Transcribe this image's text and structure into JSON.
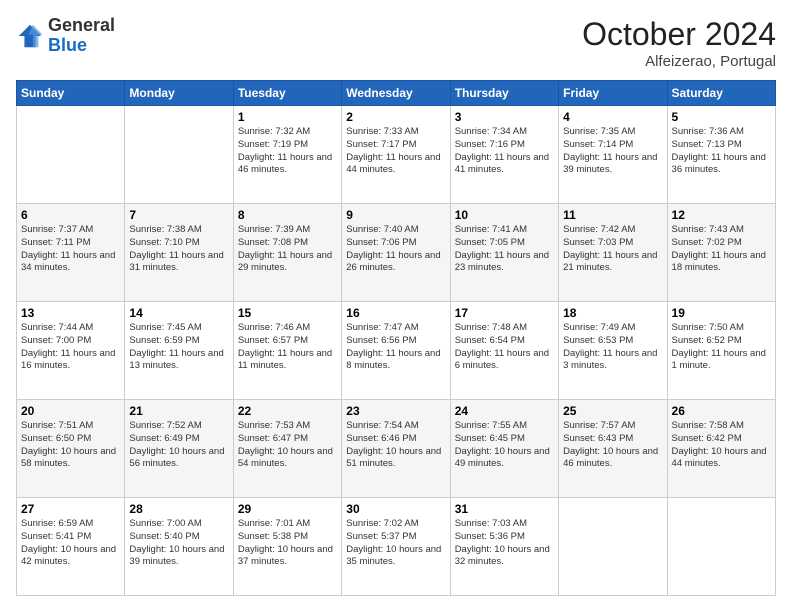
{
  "logo": {
    "general": "General",
    "blue": "Blue"
  },
  "header": {
    "month": "October 2024",
    "location": "Alfeizerao, Portugal"
  },
  "weekdays": [
    "Sunday",
    "Monday",
    "Tuesday",
    "Wednesday",
    "Thursday",
    "Friday",
    "Saturday"
  ],
  "weeks": [
    [
      null,
      null,
      {
        "day": 1,
        "sunrise": "7:32 AM",
        "sunset": "7:19 PM",
        "daylight": "11 hours and 46 minutes."
      },
      {
        "day": 2,
        "sunrise": "7:33 AM",
        "sunset": "7:17 PM",
        "daylight": "11 hours and 44 minutes."
      },
      {
        "day": 3,
        "sunrise": "7:34 AM",
        "sunset": "7:16 PM",
        "daylight": "11 hours and 41 minutes."
      },
      {
        "day": 4,
        "sunrise": "7:35 AM",
        "sunset": "7:14 PM",
        "daylight": "11 hours and 39 minutes."
      },
      {
        "day": 5,
        "sunrise": "7:36 AM",
        "sunset": "7:13 PM",
        "daylight": "11 hours and 36 minutes."
      }
    ],
    [
      {
        "day": 6,
        "sunrise": "7:37 AM",
        "sunset": "7:11 PM",
        "daylight": "11 hours and 34 minutes."
      },
      {
        "day": 7,
        "sunrise": "7:38 AM",
        "sunset": "7:10 PM",
        "daylight": "11 hours and 31 minutes."
      },
      {
        "day": 8,
        "sunrise": "7:39 AM",
        "sunset": "7:08 PM",
        "daylight": "11 hours and 29 minutes."
      },
      {
        "day": 9,
        "sunrise": "7:40 AM",
        "sunset": "7:06 PM",
        "daylight": "11 hours and 26 minutes."
      },
      {
        "day": 10,
        "sunrise": "7:41 AM",
        "sunset": "7:05 PM",
        "daylight": "11 hours and 23 minutes."
      },
      {
        "day": 11,
        "sunrise": "7:42 AM",
        "sunset": "7:03 PM",
        "daylight": "11 hours and 21 minutes."
      },
      {
        "day": 12,
        "sunrise": "7:43 AM",
        "sunset": "7:02 PM",
        "daylight": "11 hours and 18 minutes."
      }
    ],
    [
      {
        "day": 13,
        "sunrise": "7:44 AM",
        "sunset": "7:00 PM",
        "daylight": "11 hours and 16 minutes."
      },
      {
        "day": 14,
        "sunrise": "7:45 AM",
        "sunset": "6:59 PM",
        "daylight": "11 hours and 13 minutes."
      },
      {
        "day": 15,
        "sunrise": "7:46 AM",
        "sunset": "6:57 PM",
        "daylight": "11 hours and 11 minutes."
      },
      {
        "day": 16,
        "sunrise": "7:47 AM",
        "sunset": "6:56 PM",
        "daylight": "11 hours and 8 minutes."
      },
      {
        "day": 17,
        "sunrise": "7:48 AM",
        "sunset": "6:54 PM",
        "daylight": "11 hours and 6 minutes."
      },
      {
        "day": 18,
        "sunrise": "7:49 AM",
        "sunset": "6:53 PM",
        "daylight": "11 hours and 3 minutes."
      },
      {
        "day": 19,
        "sunrise": "7:50 AM",
        "sunset": "6:52 PM",
        "daylight": "11 hours and 1 minute."
      }
    ],
    [
      {
        "day": 20,
        "sunrise": "7:51 AM",
        "sunset": "6:50 PM",
        "daylight": "10 hours and 58 minutes."
      },
      {
        "day": 21,
        "sunrise": "7:52 AM",
        "sunset": "6:49 PM",
        "daylight": "10 hours and 56 minutes."
      },
      {
        "day": 22,
        "sunrise": "7:53 AM",
        "sunset": "6:47 PM",
        "daylight": "10 hours and 54 minutes."
      },
      {
        "day": 23,
        "sunrise": "7:54 AM",
        "sunset": "6:46 PM",
        "daylight": "10 hours and 51 minutes."
      },
      {
        "day": 24,
        "sunrise": "7:55 AM",
        "sunset": "6:45 PM",
        "daylight": "10 hours and 49 minutes."
      },
      {
        "day": 25,
        "sunrise": "7:57 AM",
        "sunset": "6:43 PM",
        "daylight": "10 hours and 46 minutes."
      },
      {
        "day": 26,
        "sunrise": "7:58 AM",
        "sunset": "6:42 PM",
        "daylight": "10 hours and 44 minutes."
      }
    ],
    [
      {
        "day": 27,
        "sunrise": "6:59 AM",
        "sunset": "5:41 PM",
        "daylight": "10 hours and 42 minutes."
      },
      {
        "day": 28,
        "sunrise": "7:00 AM",
        "sunset": "5:40 PM",
        "daylight": "10 hours and 39 minutes."
      },
      {
        "day": 29,
        "sunrise": "7:01 AM",
        "sunset": "5:38 PM",
        "daylight": "10 hours and 37 minutes."
      },
      {
        "day": 30,
        "sunrise": "7:02 AM",
        "sunset": "5:37 PM",
        "daylight": "10 hours and 35 minutes."
      },
      {
        "day": 31,
        "sunrise": "7:03 AM",
        "sunset": "5:36 PM",
        "daylight": "10 hours and 32 minutes."
      },
      null,
      null
    ]
  ]
}
